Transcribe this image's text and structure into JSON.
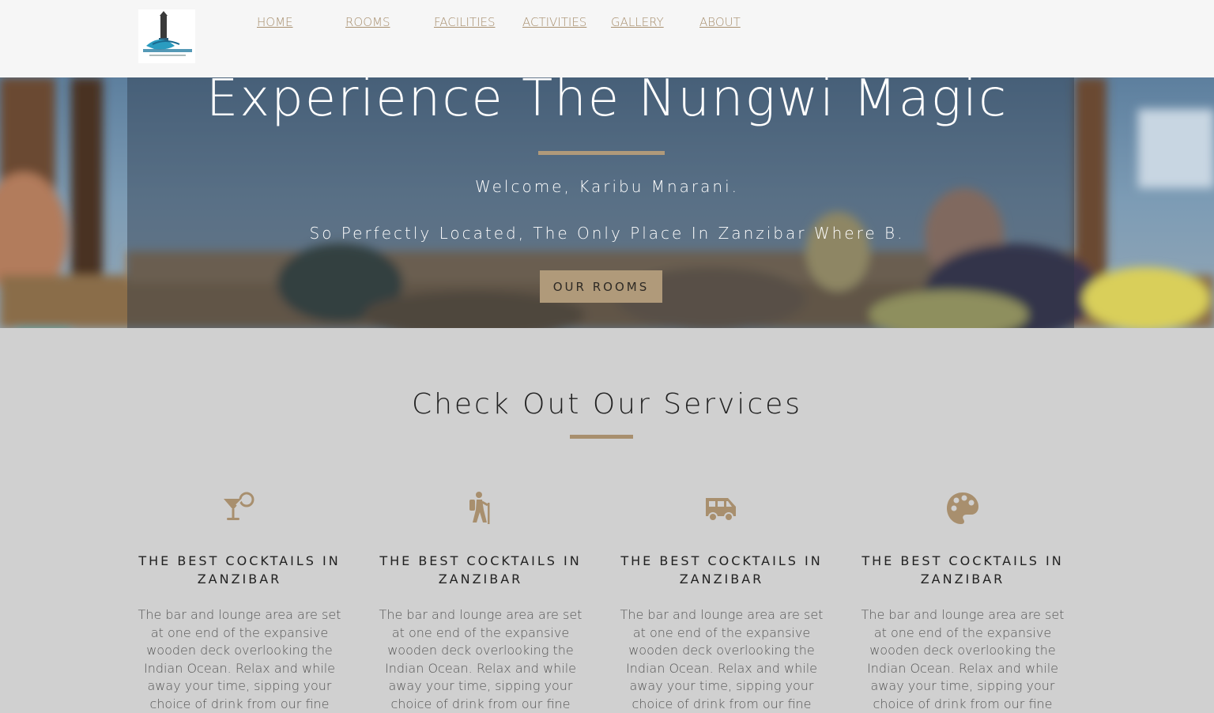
{
  "nav": {
    "logo_alt": "Mnarani",
    "links": [
      "HOME",
      "ROOMS",
      "FACILITIES",
      "ACTIVITIES",
      "GALLERY",
      "ABOUT"
    ]
  },
  "hero": {
    "title": "Experience The Nungwi Magic",
    "welcome": "Welcome, Karibu Mnarani.",
    "tagline": "So Perfectly Located, The Only Place In Zanzibar Where B.",
    "button_label": "OUR ROOMS"
  },
  "services": {
    "title": "Check Out Our Services",
    "items": [
      {
        "icon": "cocktail-icon",
        "title": "THE BEST COCKTAILS IN ZANZIBAR",
        "text": "The bar and lounge area are set at one end of the expansive wooden deck overlooking the Indian Ocean. Relax and while away your time, sipping your choice of drink from our fine"
      },
      {
        "icon": "hiking-icon",
        "title": "THE BEST COCKTAILS IN ZANZIBAR",
        "text": "The bar and lounge area are set at one end of the expansive wooden deck overlooking the Indian Ocean. Relax and while away your time, sipping your choice of drink from our fine"
      },
      {
        "icon": "shuttle-van-icon",
        "title": "THE BEST COCKTAILS IN ZANZIBAR",
        "text": "The bar and lounge area are set at one end of the expansive wooden deck overlooking the Indian Ocean. Relax and while away your time, sipping your choice of drink from our fine"
      },
      {
        "icon": "palette-icon",
        "title": "THE BEST COCKTAILS IN ZANZIBAR",
        "text": "The bar and lounge area are set at one end of the expansive wooden deck overlooking the Indian Ocean. Relax and while away your time, sipping your choice of drink from our fine"
      }
    ]
  },
  "colors": {
    "accent": "#a88f6e",
    "button": "#b09a7a",
    "nav_bg": "#f6f6f6",
    "section_bg": "#d0d0d0"
  }
}
